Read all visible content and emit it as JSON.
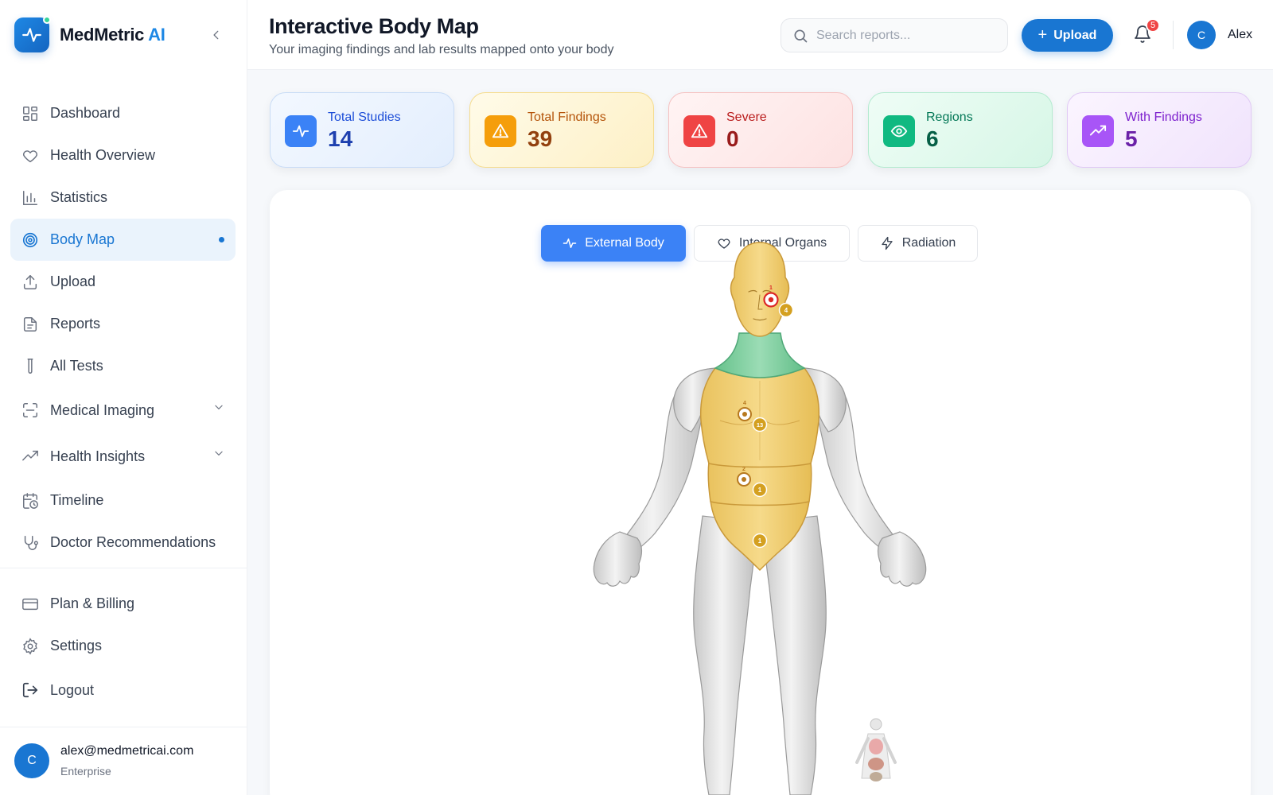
{
  "brand": {
    "name_main": "MedMetric",
    "name_accent": "AI"
  },
  "sidebar": {
    "items": [
      {
        "label": "Dashboard",
        "icon": "dashboard-icon"
      },
      {
        "label": "Health Overview",
        "icon": "heart-icon"
      },
      {
        "label": "Statistics",
        "icon": "bar-chart-icon"
      },
      {
        "label": "Body Map",
        "icon": "target-icon",
        "active": true
      },
      {
        "label": "Upload",
        "icon": "upload-icon"
      },
      {
        "label": "Reports",
        "icon": "document-icon"
      },
      {
        "label": "All Tests",
        "icon": "test-tube-icon"
      },
      {
        "label": "Medical Imaging",
        "icon": "scan-icon",
        "expandable": true
      },
      {
        "label": "Health Insights",
        "icon": "trending-up-icon",
        "expandable": true
      },
      {
        "label": "Timeline",
        "icon": "calendar-clock-icon"
      },
      {
        "label": "Doctor Recommendations",
        "icon": "stethoscope-icon"
      }
    ],
    "bottom_items": [
      {
        "label": "Plan & Billing",
        "icon": "credit-card-icon"
      },
      {
        "label": "Settings",
        "icon": "gear-icon"
      },
      {
        "label": "Logout",
        "icon": "logout-icon"
      }
    ],
    "user": {
      "initial": "C",
      "email": "alex@medmetricai.com",
      "plan": "Enterprise"
    }
  },
  "header": {
    "title": "Interactive Body Map",
    "subtitle": "Your imaging findings and lab results mapped onto your body",
    "search_placeholder": "Search reports...",
    "upload_label": "Upload",
    "notification_count": "5",
    "user_initial": "C",
    "user_name": "Alex"
  },
  "stats": [
    {
      "label": "Total Studies",
      "value": "14"
    },
    {
      "label": "Total Findings",
      "value": "39"
    },
    {
      "label": "Severe",
      "value": "0"
    },
    {
      "label": "Regions",
      "value": "6"
    },
    {
      "label": "With Findings",
      "value": "5"
    }
  ],
  "colors": {
    "accent": "#1976d2",
    "studies": "#3b82f6",
    "findings": "#f59e0b",
    "severe": "#ef4444",
    "regions": "#10b981",
    "with_findings": "#a855f7",
    "region_highlight": "#f2cf6e",
    "neck_region": "#7ccf9f"
  },
  "tabs": [
    {
      "label": "External Body",
      "icon": "activity-icon",
      "active": true
    },
    {
      "label": "Internal Organs",
      "icon": "heart-icon"
    },
    {
      "label": "Radiation",
      "icon": "lightning-icon"
    }
  ],
  "body_map": {
    "markers": [
      {
        "region": "head",
        "count": "1",
        "severity": "high"
      },
      {
        "region": "head",
        "count": "4"
      },
      {
        "region": "chest",
        "count": "4"
      },
      {
        "region": "chest",
        "count": "13"
      },
      {
        "region": "abdomen",
        "count": "2"
      },
      {
        "region": "abdomen",
        "count": "1"
      },
      {
        "region": "pelvis",
        "count": "1"
      }
    ]
  }
}
